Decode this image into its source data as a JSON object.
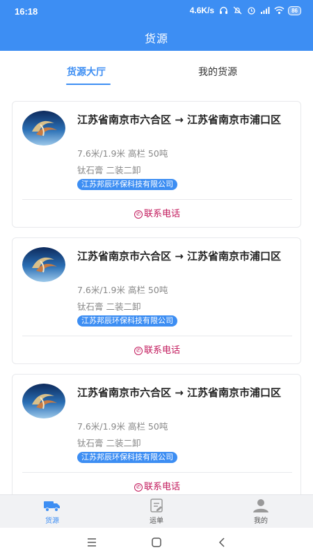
{
  "status_bar": {
    "time": "16:18",
    "network_speed": "4.6K/s",
    "battery": "86",
    "icons": [
      "headphones-icon",
      "mute-icon",
      "alarm-icon",
      "signal-icon",
      "wifi-icon",
      "battery-icon"
    ]
  },
  "header": {
    "title": "货源"
  },
  "tabs": [
    {
      "label": "货源大厅",
      "active": true
    },
    {
      "label": "我的货源",
      "active": false
    }
  ],
  "cards": [
    {
      "route": "江苏省南京市六合区 → 江苏省南京市浦口区",
      "spec": "7.6米/1.9米 高栏 50吨",
      "goods": "钛石膏 二装二卸",
      "company": "江苏邦辰环保科技有限公司",
      "contact": "联系电话"
    },
    {
      "route": "江苏省南京市六合区 → 江苏省南京市浦口区",
      "spec": "7.6米/1.9米 高栏 50吨",
      "goods": "钛石膏 二装二卸",
      "company": "江苏邦辰环保科技有限公司",
      "contact": "联系电话"
    },
    {
      "route": "江苏省南京市六合区 → 江苏省南京市浦口区",
      "spec": "7.6米/1.9米 高栏 50吨",
      "goods": "钛石膏 二装二卸",
      "company": "江苏邦辰环保科技有限公司",
      "contact": "联系电话"
    }
  ],
  "bottom_nav": [
    {
      "label": "货源",
      "icon": "truck-icon",
      "active": true
    },
    {
      "label": "运单",
      "icon": "waybill-icon",
      "active": false
    },
    {
      "label": "我的",
      "icon": "user-icon",
      "active": false
    }
  ],
  "colors": {
    "primary": "#3d8ef3",
    "contact": "#c2185b",
    "muted_text": "#888888"
  }
}
